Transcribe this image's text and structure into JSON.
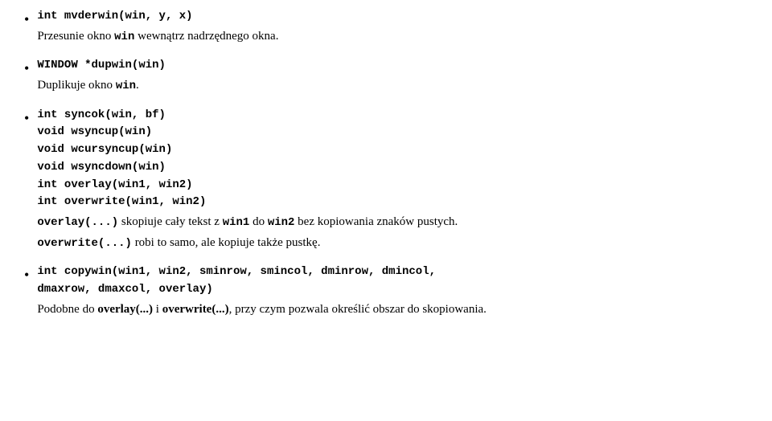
{
  "sections": [
    {
      "id": "mvderwin",
      "hasBullet": true,
      "codeLine": "int mvderwin(win, y, x)",
      "description": "Przesunie okno <code>win</code> wewnątrz nadrzędnego okna."
    },
    {
      "id": "dupwin",
      "hasBullet": true,
      "codeLine": "WINDOW *dupwin(win)",
      "description": "Duplikuje okno <code>win</code>."
    },
    {
      "id": "syncok",
      "hasBullet": true,
      "codeLines": [
        "int syncok(win, bf)",
        "void wsyncup(win)",
        "void wcursyncup(win)",
        "void wsyncdown(win)",
        "int overlay(win1, win2)",
        "int overwrite(win1, win2)"
      ],
      "description1": "overlay(...) skopiuje cały tekst z <code>win1</code> do <code>win2</code> bez kopiowania znaków pustych.",
      "description2": "overwrite(...) robi to samo, ale kopiuje także pustkę."
    },
    {
      "id": "copywin",
      "hasBullet": true,
      "codeLine": "int copywin(win1, win2, sminrow, smincol, dminrow, dmincol,",
      "codeLine2": "dmaxrow, dmaxcol, overlay)",
      "description": "Podobne do <code>overlay(...)</code> i <code>overwrite(...)</code>, przy czym pozwala określić obszar do skopiowania."
    }
  ]
}
